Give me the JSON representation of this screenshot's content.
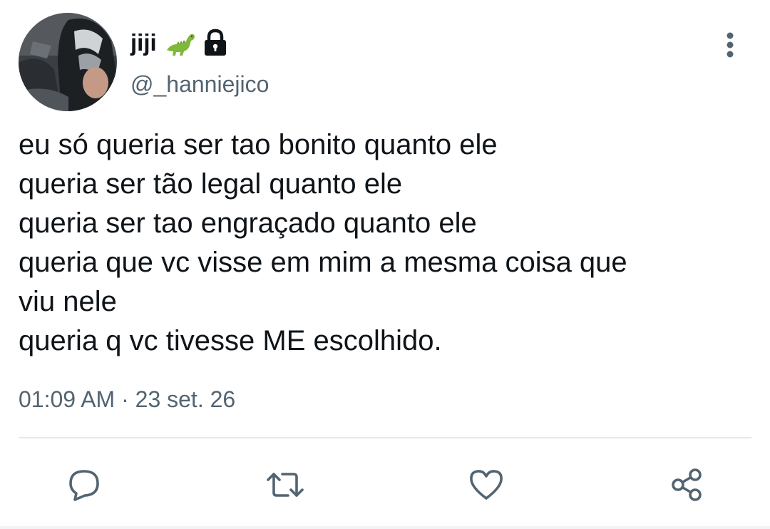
{
  "tweet": {
    "author": {
      "display_name": "jiji",
      "handle": "@_hanniejico",
      "emoji_icon": "dinosaur-emoji",
      "protected_icon": "lock-icon"
    },
    "text_lines": [
      "eu só queria ser tao bonito quanto ele",
      "queria ser tão legal quanto ele",
      "queria ser tao engraçado quanto ele",
      "queria que vc visse em mim a mesma coisa que",
      "viu nele",
      "queria q vc tivesse ME escolhido."
    ],
    "time": "01:09 AM",
    "separator": "·",
    "date": "23 set. 26"
  },
  "actions": {
    "reply_icon": "speech-bubble-icon",
    "retweet_icon": "retweet-icon",
    "like_icon": "heart-icon",
    "share_icon": "share-icon"
  },
  "menu": {
    "more_icon": "vertical-dots-icon"
  },
  "colors": {
    "text_primary": "#0f1419",
    "text_secondary": "#536471",
    "divider": "#e6e9eb",
    "icon": "#536471"
  }
}
